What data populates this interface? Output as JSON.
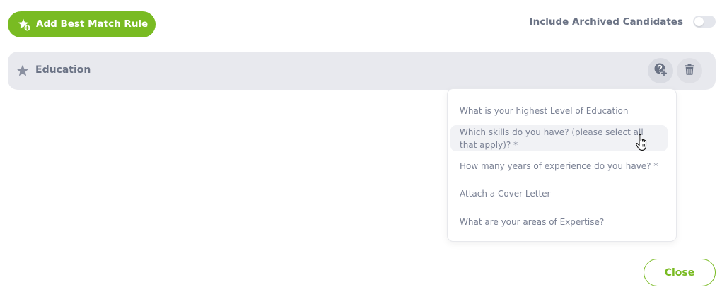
{
  "toolbar": {
    "add_rule_label": "Add Best Match Rule",
    "archived_label": "Include Archived Candidates",
    "archived_enabled": false
  },
  "rule": {
    "title": "Education"
  },
  "dropdown": {
    "items": [
      "What is your highest Level of Education",
      "Which skills do you have? (please select all that apply)? *",
      "How many years of experience do you have? *",
      "Attach a Cover Letter",
      "What are your areas of Expertise?"
    ],
    "hovered_index": 1
  },
  "footer": {
    "close_label": "Close"
  },
  "colors": {
    "accent": "#79bb22",
    "text": "#6b7385",
    "rule_bar": "#e8e9ee"
  },
  "icons": {
    "add_rule": "star-plus-icon",
    "rule": "star-icon",
    "question_add": "question-add-icon",
    "delete": "trash-icon"
  }
}
